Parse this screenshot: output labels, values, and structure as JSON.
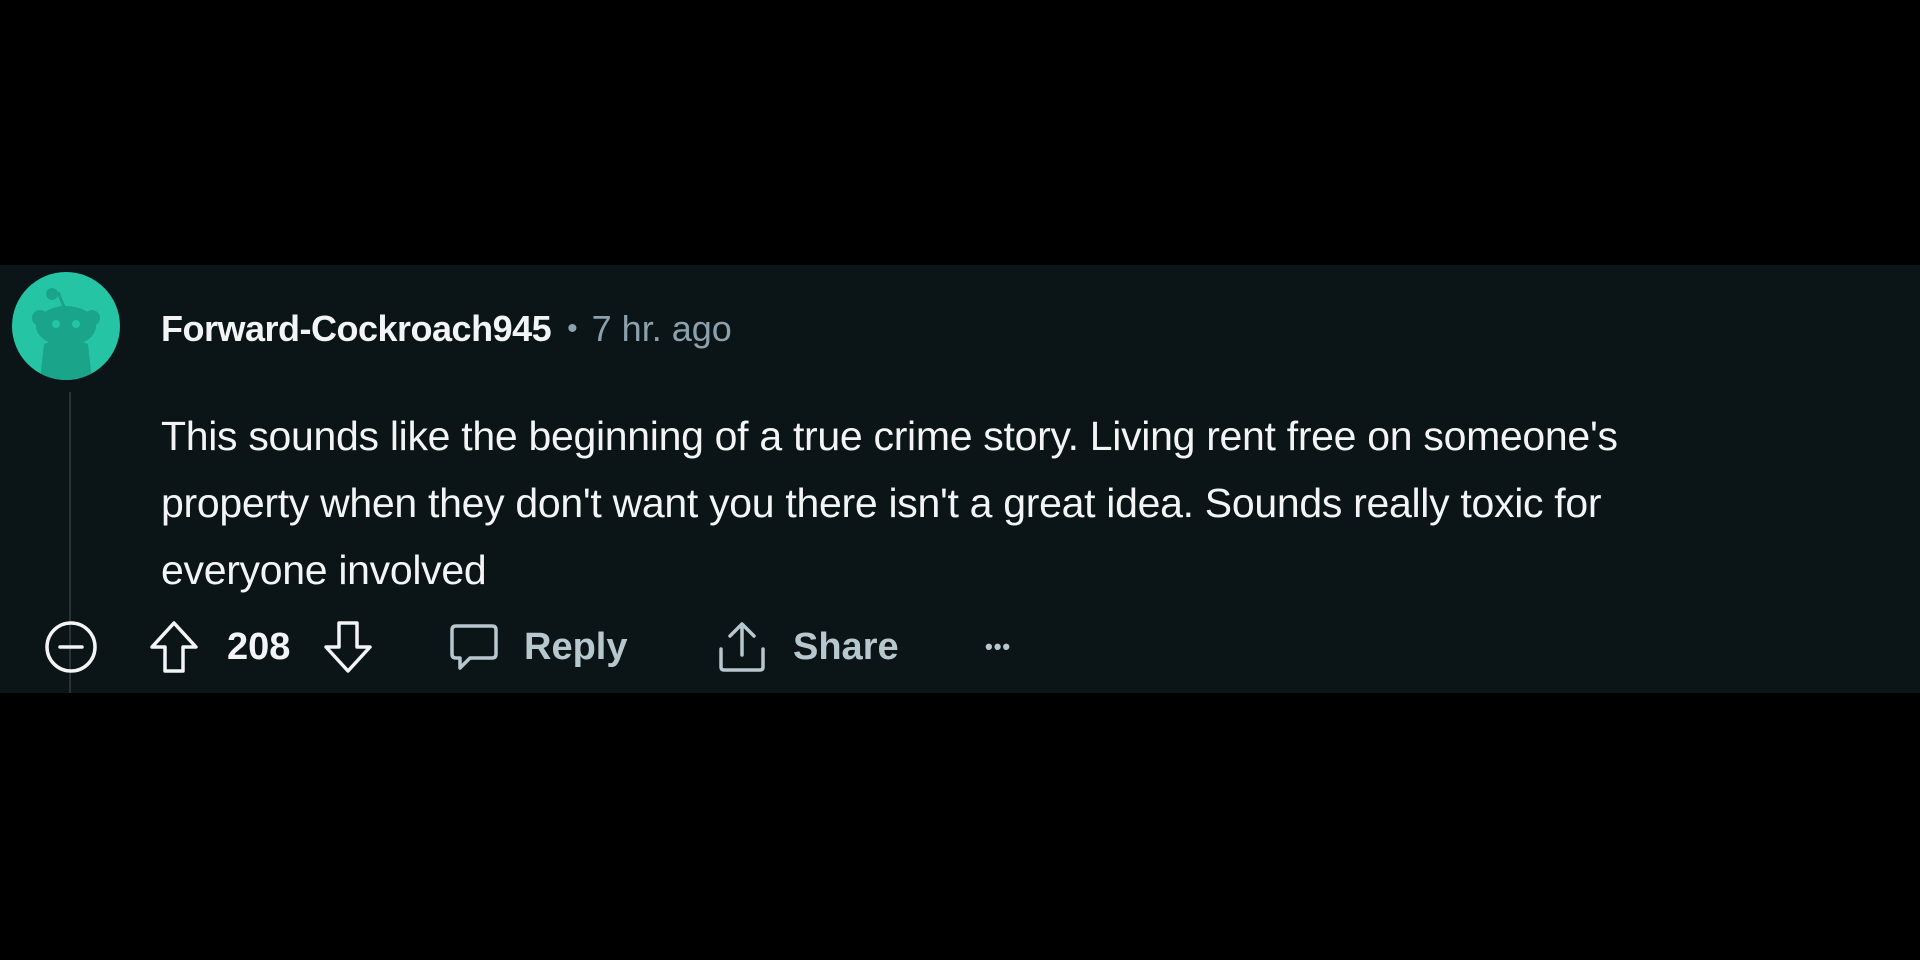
{
  "comment": {
    "author": "Forward-Cockroach945",
    "separator": "•",
    "time": "7 hr. ago",
    "body_lines": [
      "This sounds like the beginning of a true crime story. Living rent free on someone's",
      "property when they don't want you there isn't a great idea. Sounds really toxic for",
      "everyone involved"
    ],
    "score": "208",
    "actions": {
      "reply_label": "Reply",
      "share_label": "Share",
      "more_label": "•••"
    },
    "avatar": {
      "icon": "snoo-avatar-icon",
      "bg_color": "#24c4a4"
    }
  },
  "colors": {
    "background": "#000000",
    "panel": "#0b1416",
    "text": "#f2f4f5",
    "muted": "#8ba2ad"
  }
}
